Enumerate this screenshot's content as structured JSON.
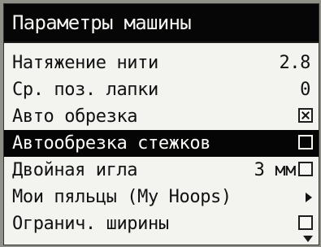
{
  "screen": {
    "title": "Параметры машины"
  },
  "menu": {
    "items": [
      {
        "label": "Натяжение нити",
        "value": "2.8"
      },
      {
        "label": "Ср. поз. лапки",
        "value": "0"
      },
      {
        "label": "Авто обрезка",
        "control": "checkbox",
        "checked": true
      },
      {
        "label": "Автообрезка стежков",
        "control": "checkbox",
        "checked": false,
        "selected": true
      },
      {
        "label": "Двойная игла",
        "value": "3 мм",
        "control": "checkbox",
        "checked": false
      },
      {
        "label": "Мои пяльцы (My Hoops)",
        "control": "submenu-arrow-icon"
      },
      {
        "label": "Огранич. ширины",
        "control": "checkbox",
        "checked": false
      }
    ]
  },
  "colors": {
    "title_background": "#060606",
    "screen_background": "#f3f3ef",
    "text": "#111111",
    "selection": "#050505"
  },
  "icons": {
    "scroll_indicator": "scroll-down-arrow-icon"
  }
}
